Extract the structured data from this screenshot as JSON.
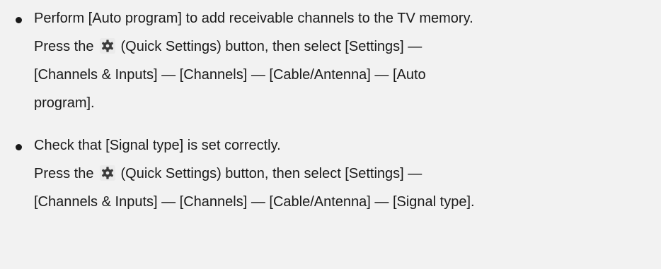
{
  "items": [
    {
      "heading": "Perform [Auto program] to add receivable channels to the TV memory.",
      "press_before": "Press the",
      "icon": "gear-icon",
      "press_after": "(Quick Settings) button, then select [Settings] —",
      "path_line_1": "[Channels & Inputs] — [Channels] — [Cable/Antenna] — [Auto",
      "path_line_2": "program]."
    },
    {
      "heading": "Check that [Signal type] is set correctly.",
      "press_before": "Press the",
      "icon": "gear-icon",
      "press_after": "(Quick Settings) button, then select [Settings] —",
      "path_line_1": "[Channels & Inputs] — [Channels] — [Cable/Antenna] — [Signal type]."
    }
  ]
}
